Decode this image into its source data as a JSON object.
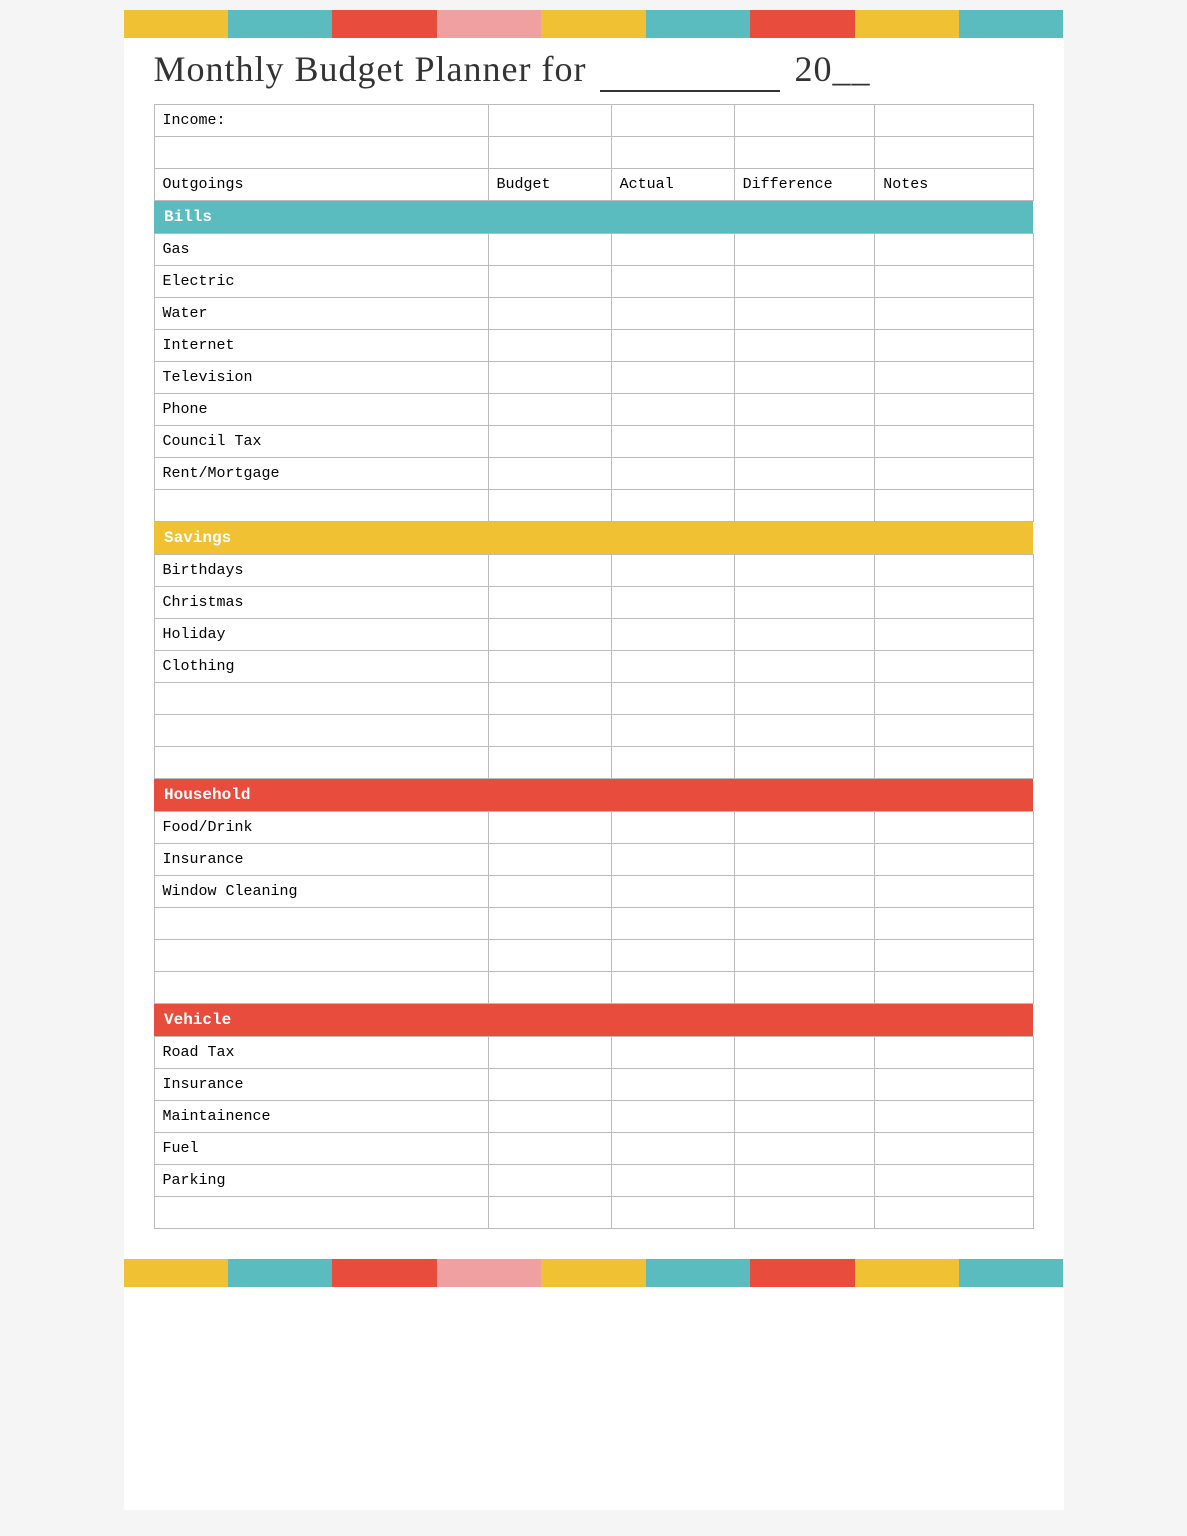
{
  "title": "Monthly Budget Planner for",
  "title_for": "for",
  "title_blank": "___________",
  "title_year": "20__",
  "income_label": "Income:",
  "columns": {
    "outgoings": "Outgoings",
    "budget": "Budget",
    "actual": "Actual",
    "difference": "Difference",
    "notes": "Notes"
  },
  "sections": [
    {
      "id": "bills",
      "label": "Bills",
      "color_class": "bills-header",
      "items": [
        "Gas",
        "Electric",
        "Water",
        "Internet",
        "Television",
        "Phone",
        "Council Tax",
        "Rent/Mortgage"
      ]
    },
    {
      "id": "savings",
      "label": "Savings",
      "color_class": "savings-header",
      "items": [
        "Birthdays",
        "Christmas",
        "Holiday",
        "Clothing"
      ]
    },
    {
      "id": "household",
      "label": "Household",
      "color_class": "household-header",
      "items": [
        "Food/Drink",
        "Insurance",
        "Window Cleaning"
      ]
    },
    {
      "id": "vehicle",
      "label": "Vehicle",
      "color_class": "vehicle-header",
      "items": [
        "Road Tax",
        "Insurance",
        "Maintainence",
        "Fuel",
        "Parking"
      ]
    }
  ],
  "banner_colors": [
    "#f0c132",
    "#5bbcbf",
    "#e84c3d",
    "#f0a0a0",
    "#f0c132",
    "#5bbcbf",
    "#e84c3d",
    "#f0c132",
    "#5bbcbf"
  ]
}
